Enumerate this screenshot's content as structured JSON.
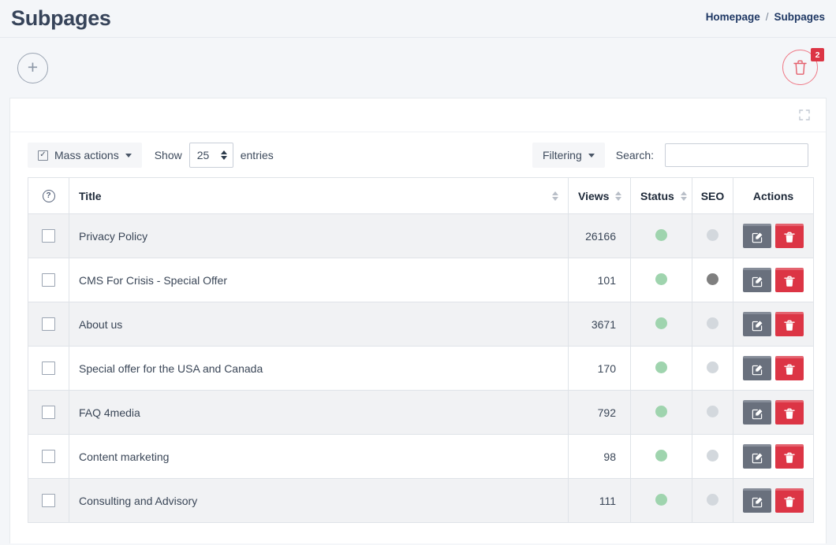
{
  "header": {
    "title": "Subpages",
    "breadcrumb": {
      "home": "Homepage",
      "separator": "/",
      "current": "Subpages"
    }
  },
  "actions": {
    "add_label": "+",
    "trash_badge": "2"
  },
  "toolbar": {
    "mass_actions_label": "Mass actions",
    "checkbox_glyph": "✓",
    "show_label": "Show",
    "entries_value": "25",
    "entries_label": "entries",
    "filtering_label": "Filtering",
    "search_label": "Search:",
    "search_value": "",
    "search_placeholder": ""
  },
  "table": {
    "columns": {
      "select": "",
      "help_glyph": "?",
      "title": "Title",
      "views": "Views",
      "status": "Status",
      "seo": "SEO",
      "actions": "Actions"
    },
    "rows": [
      {
        "title": "Privacy Policy",
        "views": "26166",
        "status": "active",
        "seo": "off"
      },
      {
        "title": "CMS For Crisis - Special Offer",
        "views": "101",
        "status": "active",
        "seo": "on"
      },
      {
        "title": "About us",
        "views": "3671",
        "status": "active",
        "seo": "off"
      },
      {
        "title": "Special offer for the USA and Canada",
        "views": "170",
        "status": "active",
        "seo": "off"
      },
      {
        "title": "FAQ 4media",
        "views": "792",
        "status": "active",
        "seo": "off"
      },
      {
        "title": "Content marketing",
        "views": "98",
        "status": "active",
        "seo": "off"
      },
      {
        "title": "Consulting and Advisory",
        "views": "111",
        "status": "active",
        "seo": "off"
      }
    ]
  },
  "colors": {
    "page_bg": "#f4f6f9",
    "status_on": "#9fd4ae",
    "seo_off": "#d3d8dd",
    "seo_on": "#7f7f7f",
    "danger": "#dc3545",
    "edit": "#69707d",
    "breadcrumb_text": "#1f3864"
  }
}
